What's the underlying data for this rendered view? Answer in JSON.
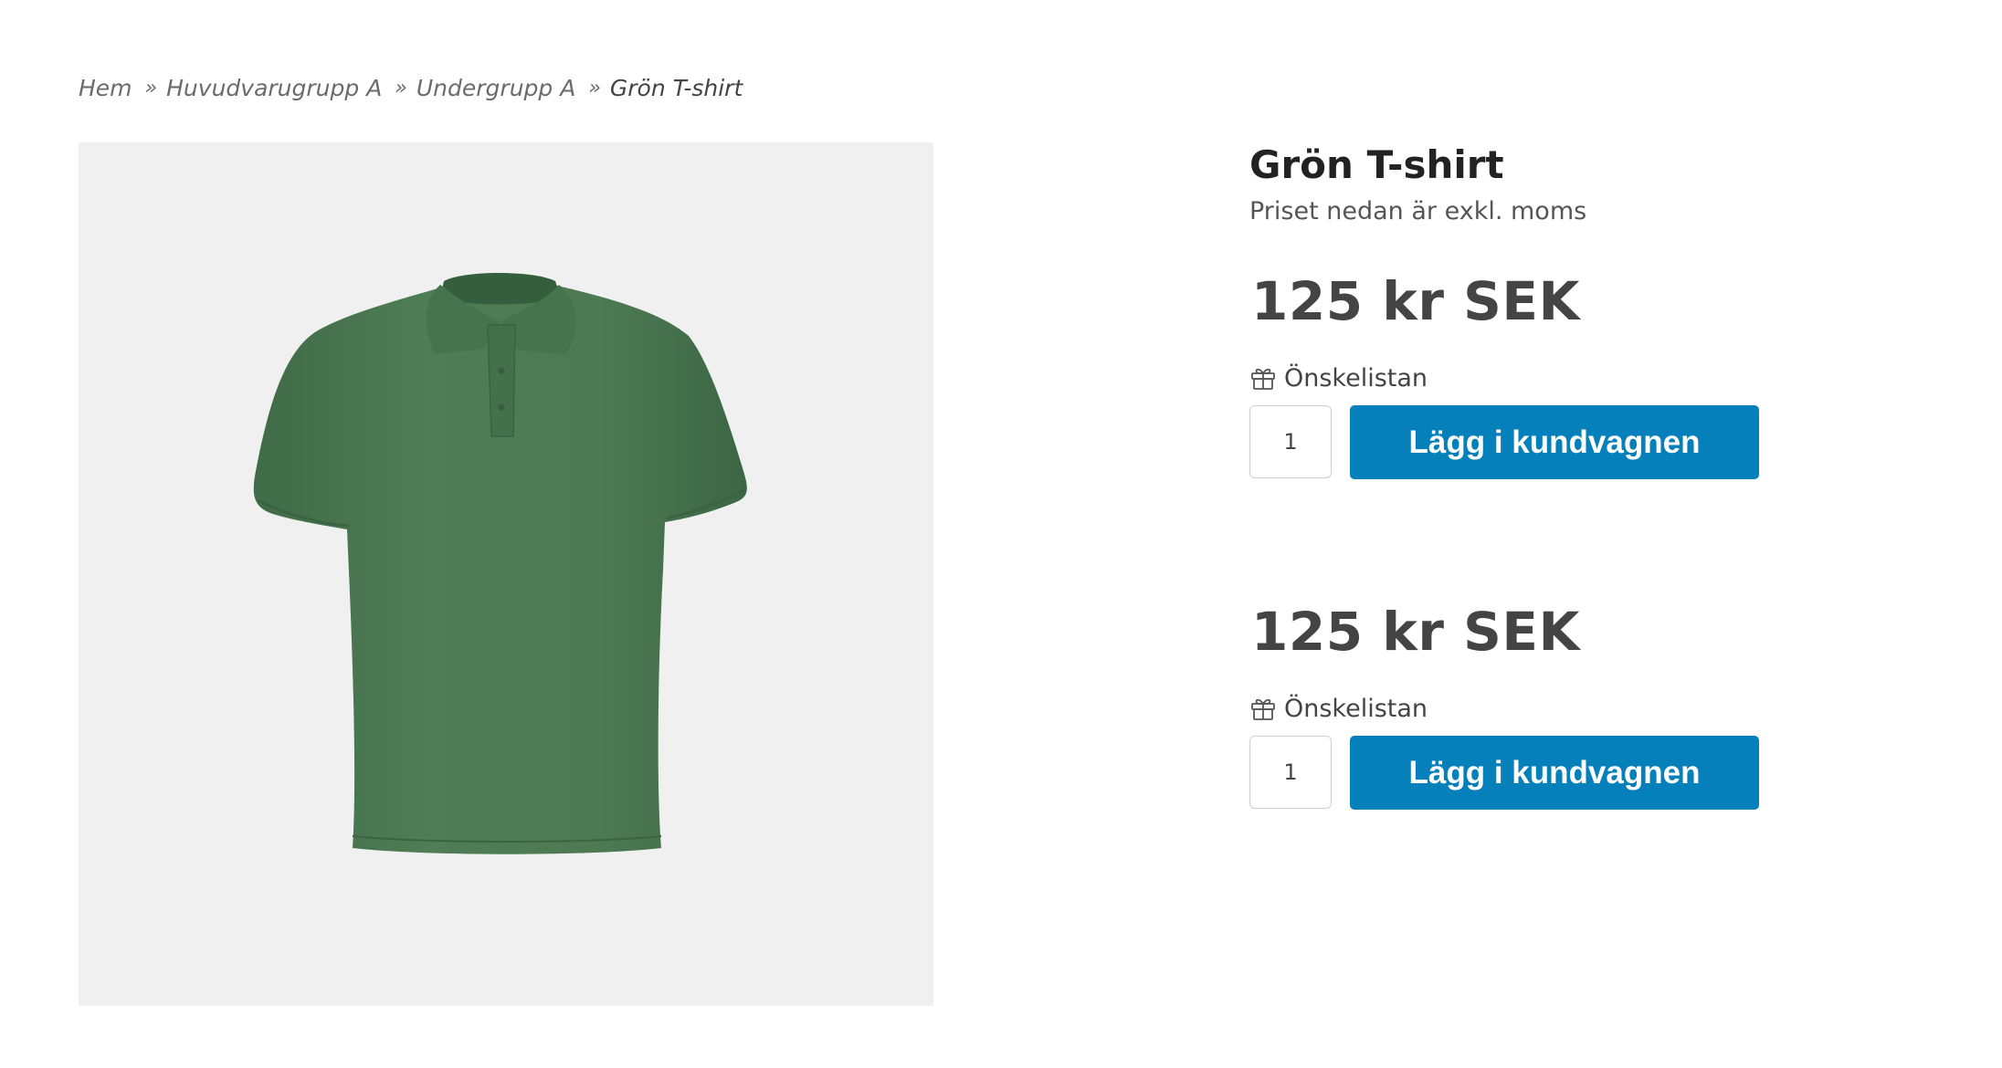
{
  "breadcrumb": {
    "items": [
      "Hem",
      "Huvudvarugrupp A",
      "Undergrupp A"
    ],
    "separator": "»",
    "current": "Grön T-shirt"
  },
  "product": {
    "title": "Grön T-shirt",
    "subtitle": "Priset nedan är exkl. moms",
    "image_icon": "green-polo-shirt"
  },
  "buy_blocks": [
    {
      "price": "125 kr SEK",
      "wishlist_label": "Önskelistan",
      "quantity": "1",
      "add_to_cart_label": "Lägg i kundvagnen"
    },
    {
      "price": "125 kr SEK",
      "wishlist_label": "Önskelistan",
      "quantity": "1",
      "add_to_cart_label": "Lägg i kundvagnen"
    }
  ],
  "colors": {
    "button": "#0580ba",
    "shirt": "#4f7d55",
    "image_bg": "#f0f0f0"
  }
}
